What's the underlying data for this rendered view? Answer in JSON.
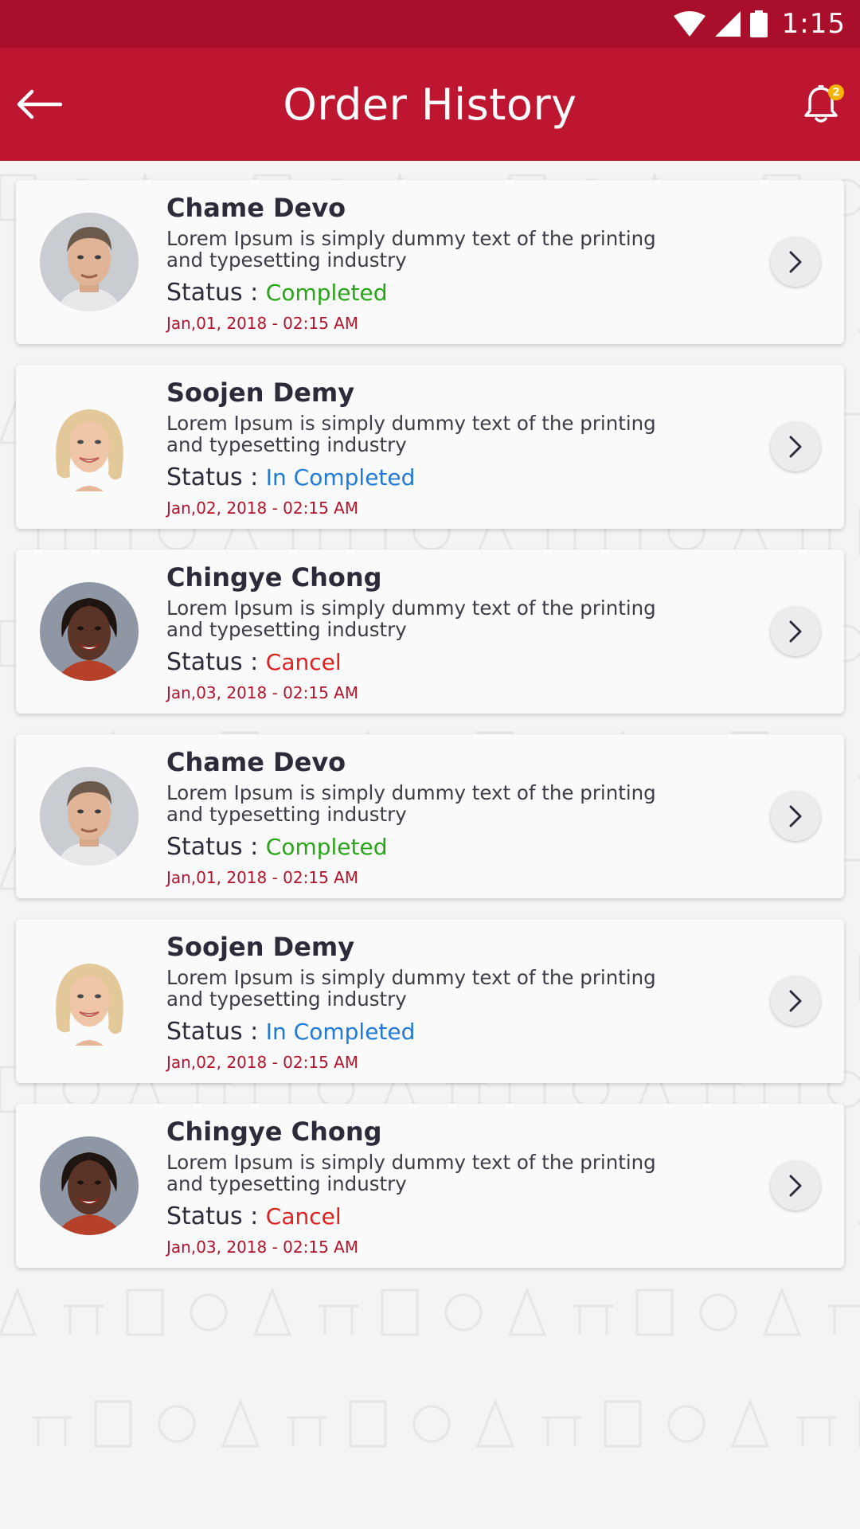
{
  "status_bar": {
    "time": "1:15"
  },
  "app_bar": {
    "title": "Order History",
    "notification_count": "2"
  },
  "status_label": "Status : ",
  "colors": {
    "primary": "#be1530",
    "primary_dark": "#a90f2a",
    "completed": "#27a617",
    "in_completed": "#1f7ad8",
    "cancel": "#e01f1f",
    "date": "#b3122b",
    "badge": "#f6b400"
  },
  "orders": [
    {
      "name": "Chame Devo",
      "desc_line1": "Lorem Ipsum is simply dummy text of the printing",
      "desc_line2": "and typesetting industry",
      "status": "Completed",
      "status_type": "completed",
      "date": "Jan,01, 2018 - 02:15 AM",
      "avatar": "man-avatar"
    },
    {
      "name": "Soojen Demy",
      "desc_line1": "Lorem Ipsum is simply dummy text of the printing",
      "desc_line2": "and typesetting industry",
      "status": "In Completed",
      "status_type": "in_completed",
      "date": "Jan,02, 2018 - 02:15 AM",
      "avatar": "blonde-woman-avatar"
    },
    {
      "name": "Chingye Chong",
      "desc_line1": "Lorem Ipsum is simply dummy text of the printing",
      "desc_line2": "and typesetting industry",
      "status": "Cancel",
      "status_type": "cancel",
      "date": "Jan,03, 2018 - 02:15 AM",
      "avatar": "dark-woman-avatar"
    },
    {
      "name": "Chame Devo",
      "desc_line1": "Lorem Ipsum is simply dummy text of the printing",
      "desc_line2": "and typesetting industry",
      "status": "Completed",
      "status_type": "completed",
      "date": "Jan,01, 2018 - 02:15 AM",
      "avatar": "man-avatar"
    },
    {
      "name": "Soojen Demy",
      "desc_line1": "Lorem Ipsum is simply dummy text of the printing",
      "desc_line2": "and typesetting industry",
      "status": "In Completed",
      "status_type": "in_completed",
      "date": "Jan,02, 2018 - 02:15 AM",
      "avatar": "blonde-woman-avatar"
    },
    {
      "name": "Chingye Chong",
      "desc_line1": "Lorem Ipsum is simply dummy text of the printing",
      "desc_line2": "and typesetting industry",
      "status": "Cancel",
      "status_type": "cancel",
      "date": "Jan,03, 2018 - 02:15 AM",
      "avatar": "dark-woman-avatar"
    }
  ]
}
